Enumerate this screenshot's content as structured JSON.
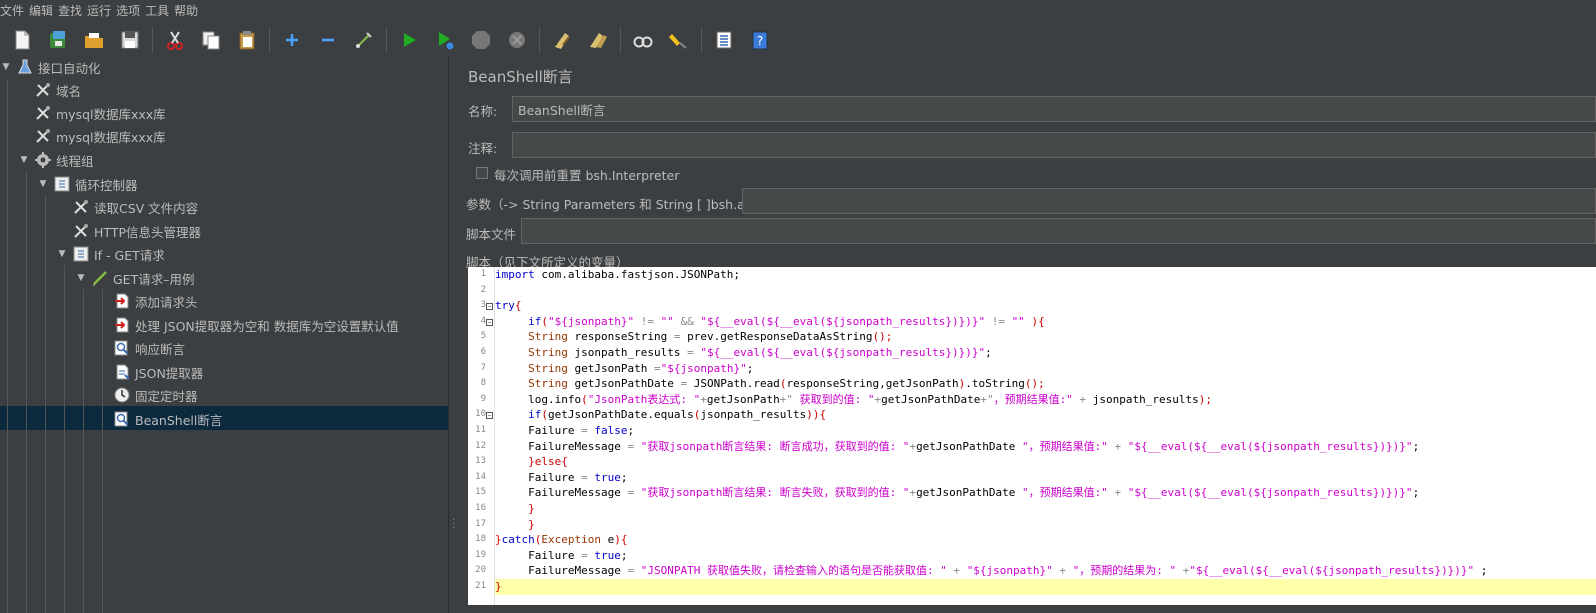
{
  "menubar": [
    "文件",
    "编辑",
    "查找",
    "运行",
    "选项",
    "工具",
    "帮助"
  ],
  "toolbar_icons": [
    "new-icon",
    "templates-icon",
    "open-icon",
    "save-icon",
    "cut-icon",
    "copy-icon",
    "paste-icon",
    "expand-icon",
    "collapse-icon",
    "toggle-icon",
    "start-icon",
    "start-no-pause-icon",
    "stop-icon",
    "shutdown-icon",
    "clear-icon",
    "clear-all-icon",
    "search-icon",
    "reset-search-icon",
    "function-helper-icon",
    "help-icon"
  ],
  "tree": {
    "root": "接口自动化",
    "n1": "域名",
    "n2": "mysql数据库xxx库",
    "n3": "mysql数据库xxx库",
    "threadgroup": "线程组",
    "loop": "循环控制器",
    "csv": "读取CSV 文件内容",
    "header": "HTTP信息头管理器",
    "ifctl": "If - GET请求",
    "sampler": "GET请求–用例",
    "s1": "添加请求头",
    "s2": "处理 JSON提取器为空和 数据库为空设置默认值",
    "s3": "响应断言",
    "s4": "JSON提取器",
    "s5": "固定定时器",
    "s6": "BeanShell断言"
  },
  "panel": {
    "title": "BeanShell断言",
    "name_label": "名称:",
    "name_value": "BeanShell断言",
    "comment_label": "注释:",
    "comment_value": "",
    "reset_label": "每次调用前重置 bsh.Interpreter",
    "params_label": "参数（-> String Parameters 和 String [ ]bsh.args）",
    "params_value": "",
    "file_label": "脚本文件",
    "file_value": "",
    "script_label": "脚本（见下文所定义的变量）"
  },
  "code": {
    "l1a": "import",
    "l1b": " com.alibaba.fastjson.JSONPath;",
    "l3a": "try",
    "l3b": "{",
    "l4a": "if",
    "l4b": "(",
    "l4c": "\"${jsonpath}\"",
    "l4d": " != ",
    "l4e": "\"\"",
    "l4f": " && ",
    "l4g": "\"${__eval(${__eval(${jsonpath_results})})}\"",
    "l4h": " != ",
    "l4i": "\"\"",
    "l4j": " ){",
    "l5a": "String",
    "l5b": " responseString ",
    "l5c": "=",
    "l5d": " prev.getResponseDataAsString",
    "l5e": "();",
    "l6a": "String",
    "l6b": " jsonpath_results ",
    "l6c": "=",
    "l6d": " \"${__eval(${__eval(${jsonpath_results})})}\"",
    "l6e": ";",
    "l7a": "String",
    "l7b": " getJsonPath ",
    "l7c": "=",
    "l7d": "\"${jsonpath}\"",
    "l7e": ";",
    "l8a": "String",
    "l8b": " getJsonPathDate ",
    "l8c": "=",
    "l8d": " JSONPath.read",
    "l8e": "(",
    "l8f": "responseString,getJsonPath",
    "l8g": ")",
    "l8h": ".toString",
    "l8i": "();",
    "l9a": "log.info",
    "l9b": "(",
    "l9c": "\"JsonPath表达式: \"",
    "l9d": "+",
    "l9e": "getJsonPath",
    "l9f": "+\" ",
    "l9g": "获取到的值: \"",
    "l9h": "+",
    "l9i": "getJsonPathDate",
    "l9j": "+\"",
    "l9k": "，预期结果值:\"",
    "l9l": " + ",
    "l9m": "jsonpath_results",
    "l9n": ");",
    "l10a": "if",
    "l10b": "(",
    "l10c": "getJsonPathDate.equals",
    "l10d": "(",
    "l10e": "jsonpath_results",
    "l10f": ")){",
    "l11a": "Failure ",
    "l11b": "=",
    "l11c": " false",
    "l11d": ";",
    "l12a": "FailureMessage ",
    "l12b": "=",
    "l12c": " \"获取jsonpath断言结果: 断言成功，获取到的值: \"",
    "l12d": "+",
    "l12e": "getJsonPathDate",
    "l12f": " \"",
    "l12g": "，预期结果值:\"",
    "l12h": " + ",
    "l12i": "\"${__eval(${__eval(${jsonpath_results})})}\"",
    "l12j": ";",
    "l13a": "}else{",
    "l14a": "Failure ",
    "l14b": "=",
    "l14c": " true",
    "l14d": ";",
    "l15a": "FailureMessage ",
    "l15b": "=",
    "l15c": " \"获取jsonpath断言结果: 断言失败，获取到的值: \"",
    "l15d": "+",
    "l15e": "getJsonPathDate",
    "l15f": " \"",
    "l15g": "，预期结果值:\"",
    "l15h": " + ",
    "l15i": "\"${__eval(${__eval(${jsonpath_results})})}\"",
    "l15j": ";",
    "l16a": "}",
    "l17a": "}",
    "l18a": "}",
    "l18b": "catch",
    "l18c": "(",
    "l18d": "Exception",
    "l18e": " e",
    "l18f": "){",
    "l19a": "Failure ",
    "l19b": "=",
    "l19c": " true",
    "l19d": ";",
    "l20a": "FailureMessage ",
    "l20b": "=",
    "l20c": " \"JSONPATH 获取值失败，请检查输入的语句是否能获取值: \"",
    "l20d": " + ",
    "l20e": "\"${jsonpath}\"",
    "l20f": " + ",
    "l20g": "\"，预期的结果为: \"",
    "l20h": " +",
    "l20i": "\"${__eval(${__eval(${jsonpath_results})})}\"",
    "l20j": " ;",
    "l21a": "}"
  },
  "line_numbers": [
    "1",
    "2",
    "3",
    "4",
    "5",
    "6",
    "7",
    "8",
    "9",
    "10",
    "11",
    "12",
    "13",
    "14",
    "15",
    "16",
    "17",
    "18",
    "19",
    "20",
    "21"
  ]
}
